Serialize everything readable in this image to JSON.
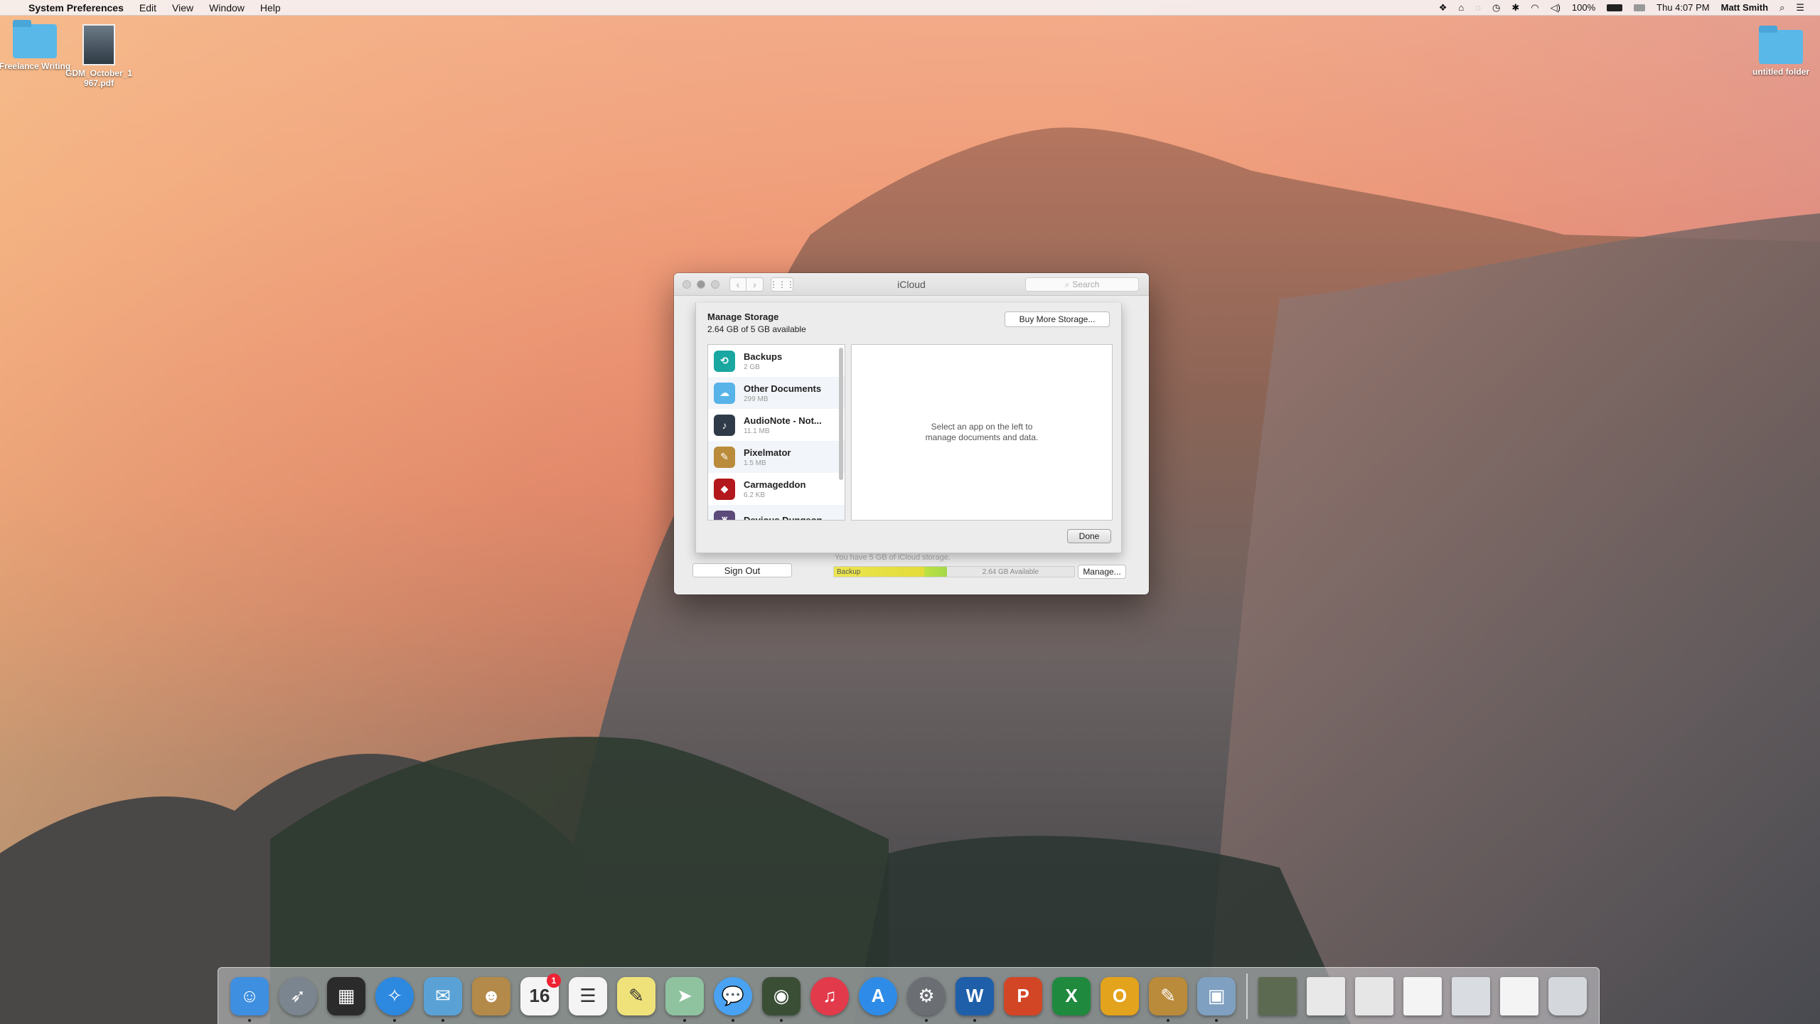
{
  "menubar": {
    "app_name": "System Preferences",
    "menus": [
      "Edit",
      "View",
      "Window",
      "Help"
    ],
    "battery": "100%",
    "clock": "Thu 4:07 PM",
    "user": "Matt Smith"
  },
  "desktop": {
    "items": [
      {
        "label": "Freelance Writing",
        "kind": "folder"
      },
      {
        "label": "GDM_October_1 967.pdf",
        "kind": "pdf"
      },
      {
        "label": "untitled folder",
        "kind": "folder"
      }
    ]
  },
  "window": {
    "title": "iCloud",
    "search_placeholder": "Search",
    "storage_note": "You have 5 GB of iCloud storage.",
    "signout_label": "Sign Out",
    "bar_used_label": "Backup",
    "bar_available_label": "2.64 GB Available",
    "bar_used_fraction": 0.47,
    "manage_label": "Manage..."
  },
  "sheet": {
    "title": "Manage Storage",
    "subtitle": "2.64 GB of 5 GB available",
    "buy_label": "Buy More Storage...",
    "detail_text": "Select an app on the left to manage documents and data.",
    "done_label": "Done",
    "apps": [
      {
        "name": "Backups",
        "size": "2 GB",
        "color": "#1aa7a1",
        "glyph": "⟲"
      },
      {
        "name": "Other Documents",
        "size": "299 MB",
        "color": "#57b3e8",
        "glyph": "☁"
      },
      {
        "name": "AudioNote - Not...",
        "size": "11.1 MB",
        "color": "#2f3b48",
        "glyph": "♪"
      },
      {
        "name": "Pixelmator",
        "size": "1.5 MB",
        "color": "#b98b3b",
        "glyph": "✎"
      },
      {
        "name": "Carmageddon",
        "size": "6.2 KB",
        "color": "#b3181c",
        "glyph": "◆"
      },
      {
        "name": "Devious Dungeon",
        "size": "",
        "color": "#5b4a7a",
        "glyph": "♜"
      }
    ]
  },
  "dock": {
    "apps": [
      {
        "name": "Finder",
        "glyph": "☺",
        "color": "#3e8fe0",
        "round": false,
        "running": true
      },
      {
        "name": "Launchpad",
        "glyph": "➶",
        "color": "#7b8590",
        "round": true,
        "running": false
      },
      {
        "name": "Mission Control",
        "glyph": "▦",
        "color": "#2b2b2b",
        "round": false,
        "running": false
      },
      {
        "name": "Safari",
        "glyph": "✧",
        "color": "#2d88e0",
        "round": true,
        "running": true
      },
      {
        "name": "Mail",
        "glyph": "✉",
        "color": "#5aa2d6",
        "round": false,
        "running": true
      },
      {
        "name": "Contacts",
        "glyph": "☻",
        "color": "#b38a4a",
        "round": false,
        "running": false
      },
      {
        "name": "Calendar",
        "glyph": "16",
        "color": "#f5f5f5",
        "round": false,
        "running": false,
        "badge": "1"
      },
      {
        "name": "Reminders",
        "glyph": "☰",
        "color": "#f4f4f4",
        "round": false,
        "running": false
      },
      {
        "name": "Notes",
        "glyph": "✎",
        "color": "#f0e27a",
        "round": false,
        "running": false
      },
      {
        "name": "Maps",
        "glyph": "➤",
        "color": "#8fc3a0",
        "round": false,
        "running": true
      },
      {
        "name": "Messages",
        "glyph": "💬",
        "color": "#4aa2f2",
        "round": true,
        "running": true
      },
      {
        "name": "Photo Booth",
        "glyph": "◉",
        "color": "#3a4e36",
        "round": false,
        "running": true
      },
      {
        "name": "iTunes",
        "glyph": "♫",
        "color": "#e23a4a",
        "round": true,
        "running": false
      },
      {
        "name": "App Store",
        "glyph": "A",
        "color": "#2e8ce8",
        "round": true,
        "running": false
      },
      {
        "name": "System Preferences",
        "glyph": "⚙",
        "color": "#6b6f74",
        "round": true,
        "running": true
      },
      {
        "name": "Word",
        "glyph": "W",
        "color": "#1f5faa",
        "round": false,
        "running": true
      },
      {
        "name": "PowerPoint",
        "glyph": "P",
        "color": "#d24626",
        "round": false,
        "running": false
      },
      {
        "name": "Excel",
        "glyph": "X",
        "color": "#1f8a3e",
        "round": false,
        "running": false
      },
      {
        "name": "Outlook",
        "glyph": "O",
        "color": "#e3a31c",
        "round": false,
        "running": false
      },
      {
        "name": "Pixelmator",
        "glyph": "✎",
        "color": "#b98b3b",
        "round": false,
        "running": true
      },
      {
        "name": "Preview",
        "glyph": "▣",
        "color": "#7fa0c0",
        "round": false,
        "running": true
      }
    ],
    "docs": [
      {
        "name": "presentation-doc",
        "color": "#5d6a52"
      },
      {
        "name": "document-1",
        "color": "#e8e8e8"
      },
      {
        "name": "document-2",
        "color": "#e6e6e6"
      },
      {
        "name": "word-doc-1",
        "color": "#f4f4f4"
      },
      {
        "name": "screenshot-doc",
        "color": "#d9dde2"
      },
      {
        "name": "word-doc-2",
        "color": "#f4f4f4"
      },
      {
        "name": "trash",
        "color": "#d4d8dc"
      }
    ]
  }
}
